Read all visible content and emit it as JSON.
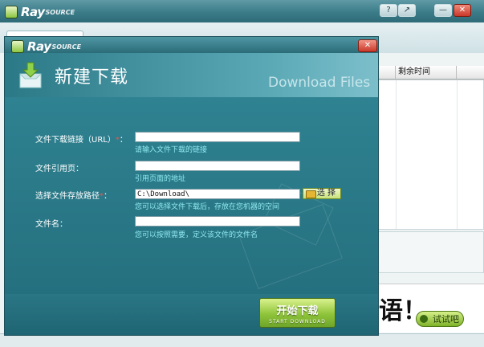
{
  "main_window": {
    "brand": {
      "name": "Ray",
      "suffix": "SOURCE"
    },
    "title_buttons": {
      "help": "?",
      "restore": "↗",
      "minimize": "—",
      "close": "✕"
    },
    "table": {
      "column_remaining_time": "剩余时间"
    },
    "ad": {
      "text": "语！",
      "try_button": "试试吧"
    }
  },
  "dialog": {
    "brand": {
      "name": "Ray",
      "suffix": "SOURCE"
    },
    "close_glyph": "✕",
    "title": "新建下载",
    "subtitle": "Download Files",
    "fields": {
      "url": {
        "label": "文件下载链接（URL）",
        "required": "*",
        "colon": "：",
        "value": "",
        "hint": "请输入文件下载的链接"
      },
      "referer": {
        "label": "文件引用页：",
        "value": "",
        "hint": "引用页面的地址"
      },
      "save_path": {
        "label": "选择文件存放路径",
        "required": "*",
        "colon": "：",
        "value": "C:\\Download\\",
        "hint": "您可以选择文件下载后，存放在您机器的空间",
        "browse_label": "选 择"
      },
      "filename": {
        "label": "文件名：",
        "value": "",
        "hint": "您可以按照需要，定义该文件的文件名"
      }
    },
    "start_button": {
      "label_cn": "开始下载",
      "label_en": "START DOWNLOAD"
    }
  },
  "colors": {
    "accent_teal": "#2f7f8e",
    "button_green": "#8fc43a",
    "hint_cyan": "#8fe9f0",
    "required_red": "#ff4a3a"
  }
}
